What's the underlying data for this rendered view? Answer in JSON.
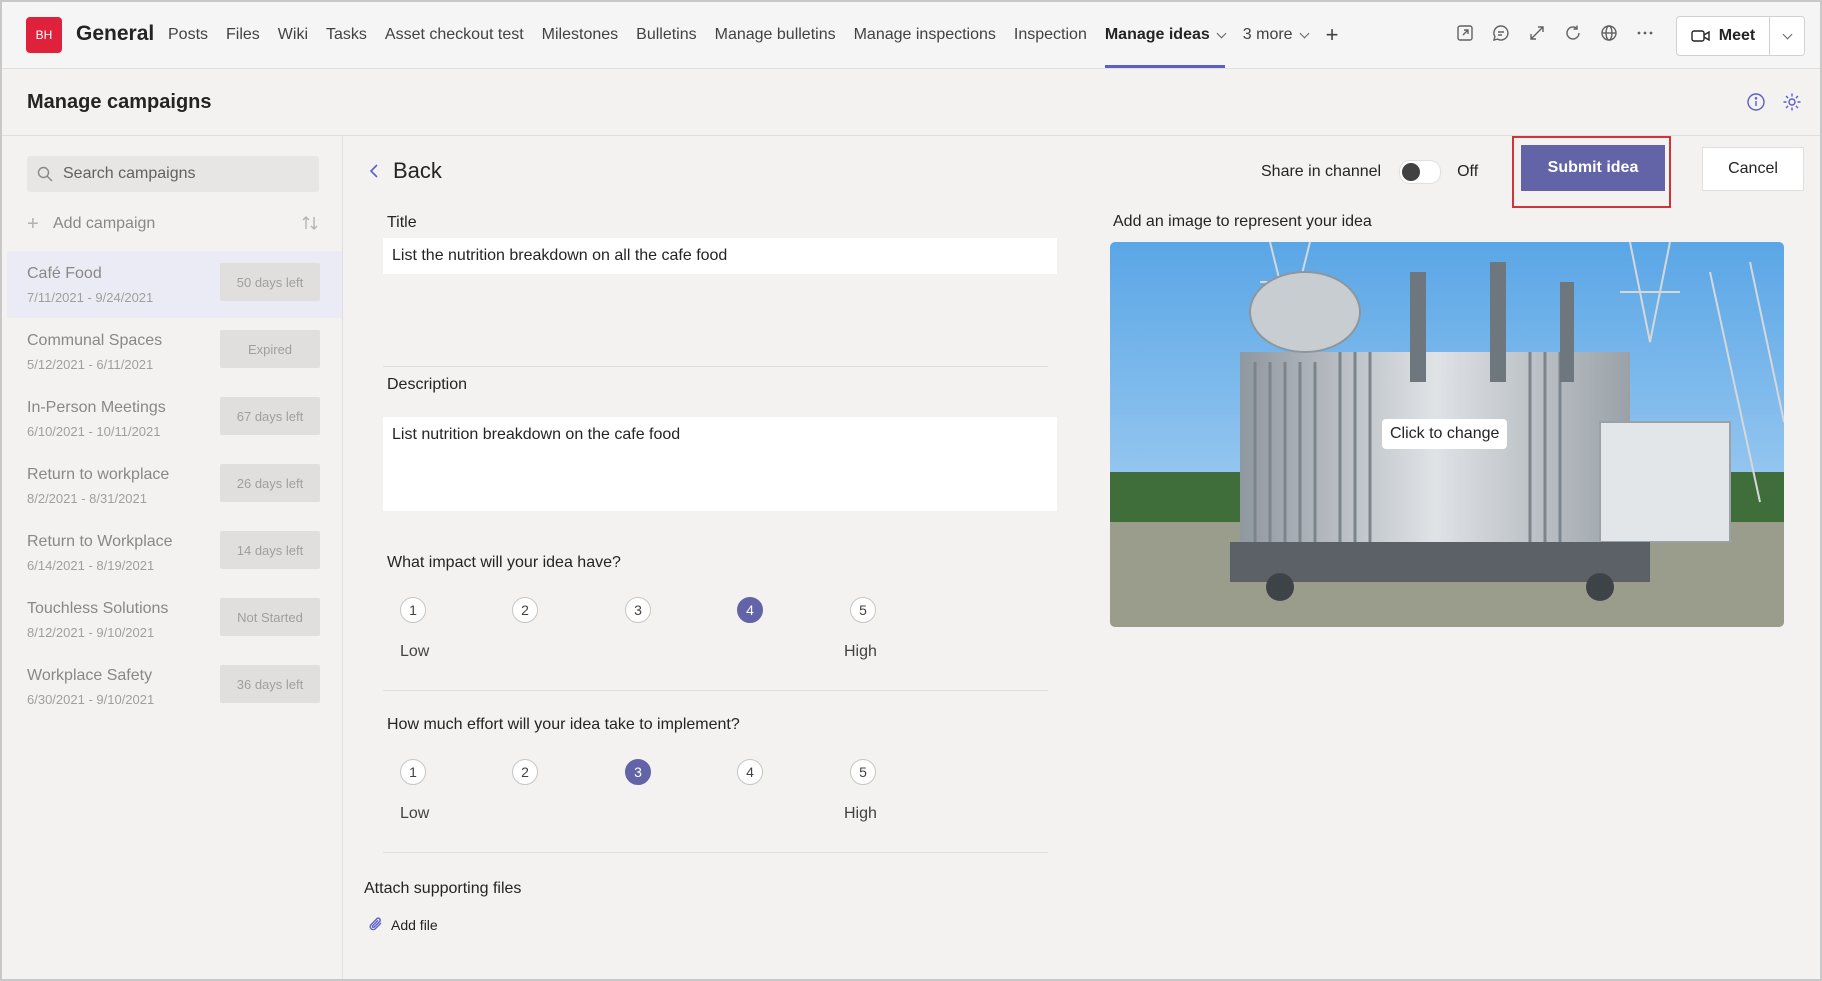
{
  "header": {
    "avatar_initials": "BH",
    "channel": "General",
    "tabs": [
      {
        "label": "Posts"
      },
      {
        "label": "Files"
      },
      {
        "label": "Wiki"
      },
      {
        "label": "Tasks"
      },
      {
        "label": "Asset checkout test"
      },
      {
        "label": "Milestones"
      },
      {
        "label": "Bulletins"
      },
      {
        "label": "Manage bulletins"
      },
      {
        "label": "Manage inspections"
      },
      {
        "label": "Inspection"
      },
      {
        "label": "Manage ideas"
      },
      {
        "label": "3 more"
      }
    ],
    "active_tab": "Manage ideas",
    "meet_label": "Meet"
  },
  "page": {
    "title": "Manage campaigns"
  },
  "sidebar": {
    "search_placeholder": "Search campaigns",
    "add_label": "Add campaign",
    "campaigns": [
      {
        "name": "Café Food",
        "dates": "7/11/2021 - 9/24/2021",
        "status": "50 days left",
        "selected": true
      },
      {
        "name": "Communal Spaces",
        "dates": "5/12/2021 - 6/11/2021",
        "status": "Expired"
      },
      {
        "name": "In-Person Meetings",
        "dates": "6/10/2021 - 10/11/2021",
        "status": "67 days left"
      },
      {
        "name": "Return to workplace",
        "dates": "8/2/2021 - 8/31/2021",
        "status": "26 days left"
      },
      {
        "name": "Return to Workplace",
        "dates": "6/14/2021 - 8/19/2021",
        "status": "14 days left"
      },
      {
        "name": "Touchless Solutions",
        "dates": "8/12/2021 - 9/10/2021",
        "status": "Not Started"
      },
      {
        "name": "Workplace Safety",
        "dates": "6/30/2021 - 9/10/2021",
        "status": "36 days left"
      }
    ]
  },
  "form": {
    "back_label": "Back",
    "share_label": "Share in channel",
    "share_state": "Off",
    "submit_label": "Submit idea",
    "cancel_label": "Cancel",
    "title_label": "Title",
    "title_value": "List the nutrition breakdown on all the cafe food",
    "description_label": "Description",
    "description_value": "List nutrition breakdown on the cafe food",
    "impact_question": "What impact will your idea have?",
    "impact_selected": 4,
    "effort_question": "How much effort will your idea take to implement?",
    "effort_selected": 3,
    "scale": [
      "1",
      "2",
      "3",
      "4",
      "5"
    ],
    "low_label": "Low",
    "high_label": "High",
    "image_label": "Add an image to represent your idea",
    "image_overlay": "Click to change",
    "attach_label": "Attach supporting files",
    "add_file_label": "Add file"
  },
  "colors": {
    "accent": "#6264a7",
    "highlight": "#d13438",
    "avatar": "#e0213c"
  },
  "icons": [
    "search-icon",
    "sort-icon",
    "chevron-left-icon",
    "info-icon",
    "gear-icon",
    "paperclip-icon",
    "video-icon",
    "chat-icon",
    "expand-icon",
    "refresh-icon",
    "globe-icon",
    "more-icon",
    "popout-icon"
  ]
}
